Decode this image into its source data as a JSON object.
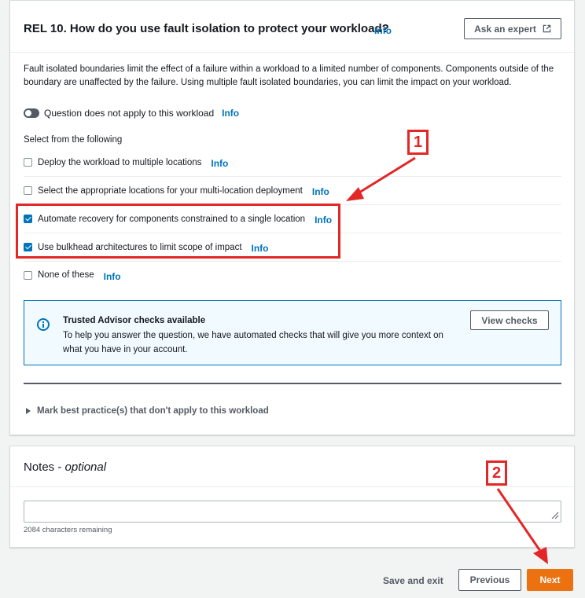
{
  "question": {
    "title": "REL 10. How do you use fault isolation to protect your workload?",
    "info_label": "Info",
    "ask_expert_label": "Ask an expert",
    "description": "Fault isolated boundaries limit the effect of a failure within a workload to a limited number of components. Components outside of the boundary are unaffected by the failure. Using multiple fault isolated boundaries, you can limit the impact on your workload.",
    "not_applicable_label": "Question does not apply to this workload",
    "not_applicable_info": "Info",
    "select_label": "Select from the following",
    "choices": [
      {
        "label": "Deploy the workload to multiple locations",
        "info": "Info",
        "checked": false
      },
      {
        "label": "Select the appropriate locations for your multi-location deployment",
        "info": "Info",
        "checked": false
      },
      {
        "label": "Automate recovery for components constrained to a single location",
        "info": "Info",
        "checked": true
      },
      {
        "label": "Use bulkhead architectures to limit scope of impact",
        "info": "Info",
        "checked": true
      },
      {
        "label": "None of these",
        "info": "Info",
        "checked": false
      }
    ],
    "trusted_advisor": {
      "title": "Trusted Advisor checks available",
      "text": "To help you answer the question, we have automated checks that will give you more context on what you have in your account.",
      "button_label": "View checks",
      "icon": "info-circle-icon"
    },
    "expander_label": "Mark best practice(s) that don't apply to this workload"
  },
  "notes": {
    "title": "Notes - ",
    "title_optional": "optional",
    "value": "",
    "chars_remaining": "2084 characters remaining"
  },
  "footer": {
    "save_exit_label": "Save and exit",
    "previous_label": "Previous",
    "next_label": "Next"
  },
  "annotations": {
    "badge_1": "1",
    "badge_2": "2",
    "color": "#e32626"
  },
  "colors": {
    "link": "#0073bb",
    "primary_button": "#ec7211",
    "info_box_bg": "#f1faff"
  }
}
